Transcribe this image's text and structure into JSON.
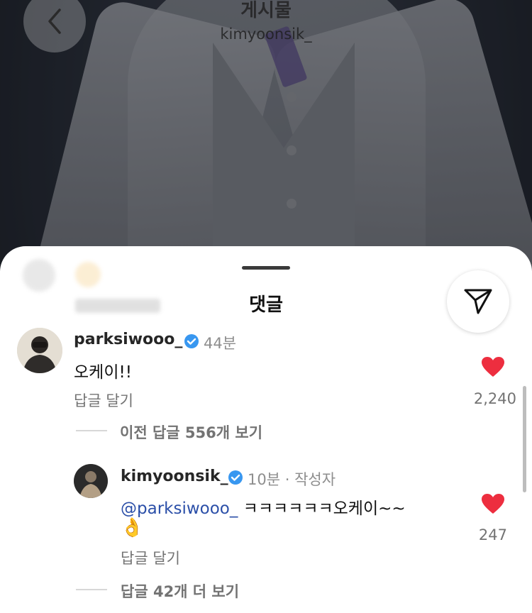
{
  "header": {
    "title": "게시물",
    "username": "kimyoonsik_"
  },
  "sheet": {
    "title": "댓글"
  },
  "comments": [
    {
      "username": "parksiwooo_",
      "time": "44분",
      "text": "오케이!!",
      "reply_label": "답글 달기",
      "likes": "2,240",
      "view_replies": "이전 답글 556개 보기"
    }
  ],
  "reply": {
    "username": "kimyoonsik_",
    "meta": "10분 · 작성자",
    "mention": "@parksiwooo_",
    "text": " ㅋㅋㅋㅋㅋㅋ오케이~~",
    "emoji": "👌",
    "reply_label": "답글 달기",
    "likes": "247",
    "more_replies": "답글 42개 더 보기"
  },
  "colors": {
    "heart": "#ed2e3f",
    "verified": "#3897f0",
    "mention": "#2b4fa8"
  }
}
